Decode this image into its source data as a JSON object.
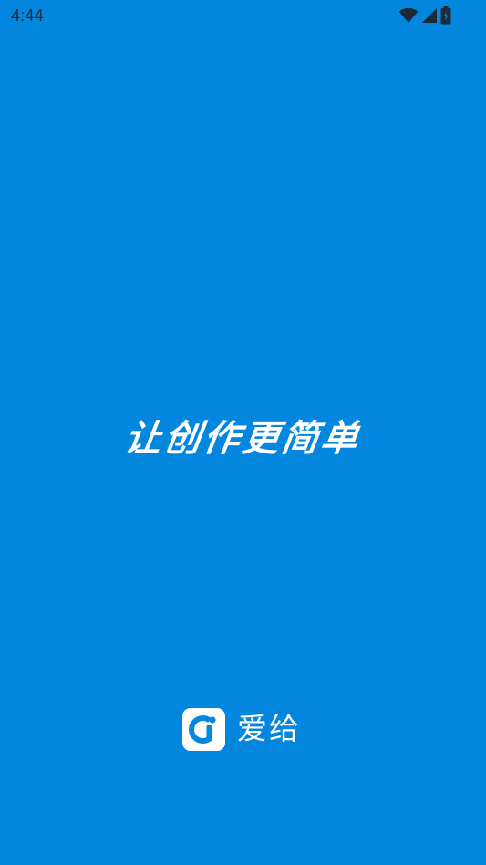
{
  "status_bar": {
    "time": "4:44",
    "icons": [
      "wifi-icon",
      "signal-icon",
      "battery-icon"
    ]
  },
  "splash": {
    "slogan": "让创作更简单",
    "brand_name": "爱给",
    "logo_icon": "aigei-logo-icon"
  },
  "colors": {
    "background": "#0387DE",
    "text": "#FFFFFF",
    "status_text": "#1B2A36"
  }
}
